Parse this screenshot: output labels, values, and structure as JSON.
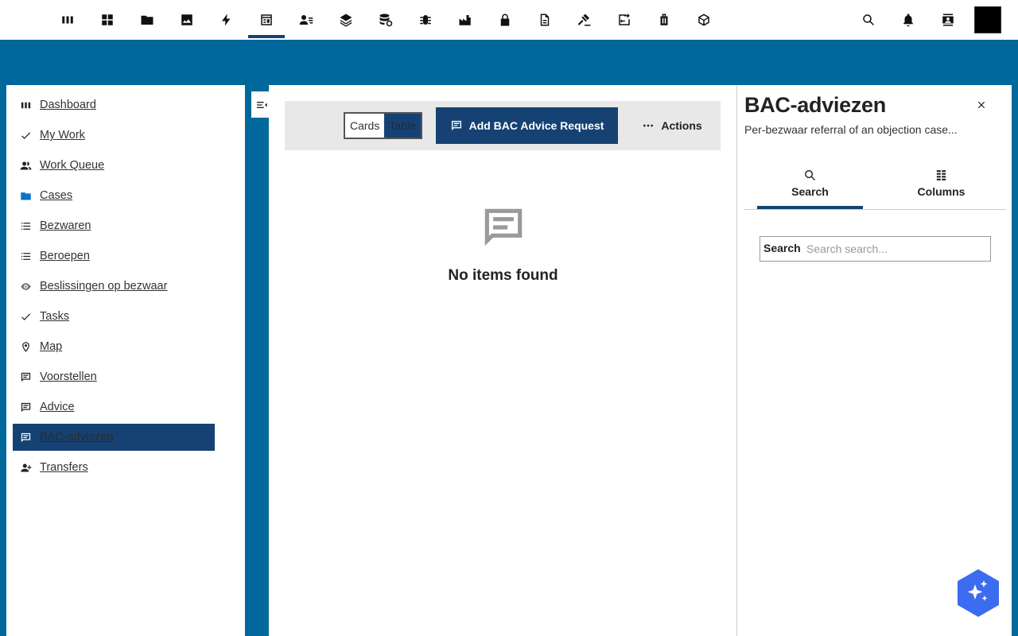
{
  "topbar": {
    "icons": [
      "dashboard-columns-icon",
      "grid-icon",
      "folder-icon",
      "image-icon",
      "lightning-icon",
      "table-chart-icon",
      "person-list-icon",
      "layers-icon",
      "database-sync-icon",
      "bug-icon",
      "factory-icon",
      "lock-icon",
      "document-icon",
      "gavel-icon",
      "swap-box-icon",
      "luggage-icon",
      "package-icon"
    ],
    "active_index": 5,
    "right_icons": [
      "search-icon",
      "notification-bell-icon",
      "contact-card-icon"
    ]
  },
  "sidebar": {
    "items": [
      {
        "label": "Dashboard",
        "icon": "dashboard-columns-icon"
      },
      {
        "label": "My Work",
        "icon": "check-icon"
      },
      {
        "label": "Work Queue",
        "icon": "people-icon"
      },
      {
        "label": "Cases",
        "icon": "folder-icon"
      },
      {
        "label": "Bezwaren",
        "icon": "list-icon"
      },
      {
        "label": "Beroepen",
        "icon": "list-icon"
      },
      {
        "label": "Beslissingen op bezwaar",
        "icon": "eye-icon"
      },
      {
        "label": "Tasks",
        "icon": "check-icon"
      },
      {
        "label": "Map",
        "icon": "map-pin-icon"
      },
      {
        "label": "Voorstellen",
        "icon": "comment-icon"
      },
      {
        "label": "Advice",
        "icon": "comment-icon"
      },
      {
        "label": "BAC-adviezen",
        "icon": "comment-icon"
      },
      {
        "label": "Transfers",
        "icon": "person-add-icon"
      }
    ],
    "active": "BAC-adviezen"
  },
  "toolbar": {
    "view_toggle": {
      "cards_label": "Cards",
      "table_label": "Table",
      "selected": "Table"
    },
    "add_label": "Add BAC Advice Request",
    "actions_label": "Actions"
  },
  "main": {
    "empty_text": "No items found"
  },
  "right_panel": {
    "title": "BAC-adviezen",
    "subtitle": "Per-bezwaar referral of an objection case...",
    "tabs": [
      {
        "label": "Search",
        "icon": "search-icon"
      },
      {
        "label": "Columns",
        "icon": "columns-icon"
      }
    ],
    "active_tab": "Search",
    "search_label": "Search",
    "search_placeholder": "Search search..."
  },
  "colors": {
    "brand_blue": "#01689b",
    "dark_blue": "#154273",
    "fab": "#3b6cf0"
  }
}
